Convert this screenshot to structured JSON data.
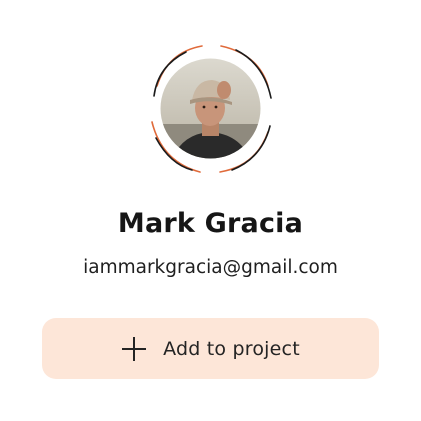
{
  "user": {
    "name": "Mark Gracia",
    "email": "iammarkgracia@gmail.com"
  },
  "actions": {
    "add_to_project_label": "Add to project"
  },
  "icons": {
    "add": "plus-icon",
    "avatar": "user-avatar"
  },
  "colors": {
    "accent": "#e06a3a",
    "button_bg": "#fde6d8"
  }
}
